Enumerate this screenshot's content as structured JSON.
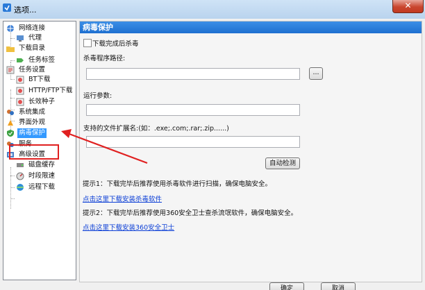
{
  "window": {
    "title": "选项...",
    "close_glyph": "✕"
  },
  "tree": {
    "items": [
      {
        "label": "网络连接",
        "icon": "network-icon"
      },
      {
        "label": "代理",
        "icon": "proxy-icon"
      },
      {
        "label": "下载目录",
        "icon": "folder-icon"
      },
      {
        "label": "任务标签",
        "icon": "tag-icon"
      },
      {
        "label": "任务设置",
        "icon": "task-settings-icon"
      },
      {
        "label": "BT下载",
        "icon": "bt-icon"
      },
      {
        "label": "HTTP/FTP下载",
        "icon": "http-icon"
      },
      {
        "label": "长效种子",
        "icon": "seed-icon"
      },
      {
        "label": "系统集成",
        "icon": "integration-icon"
      },
      {
        "label": "界面外观",
        "icon": "appearance-icon"
      },
      {
        "label": "病毒保护",
        "icon": "shield-icon",
        "selected": true
      },
      {
        "label": "服务",
        "icon": "service-icon"
      },
      {
        "label": "高级设置",
        "icon": "advanced-icon"
      },
      {
        "label": "磁盘缓存",
        "icon": "disk-icon"
      },
      {
        "label": "时段限速",
        "icon": "speed-icon"
      },
      {
        "label": "远程下载",
        "icon": "remote-icon"
      }
    ]
  },
  "panel": {
    "title": "病毒保护",
    "scan_after_download": "下载完成后杀毒",
    "antivirus_path_label": "杀毒程序路径:",
    "antivirus_path_value": "",
    "browse_label": "...",
    "run_params_label": "运行参数:",
    "run_params_value": "",
    "extensions_label": "支持的文件扩展名:(如：.exe;.com;.rar;.zip......)",
    "extensions_value": "",
    "auto_detect_label": "自动检测",
    "tip1": "提示1：下载完毕后推荐使用杀毒软件进行扫描，确保电脑安全。",
    "link1": "点击这里下载安装杀毒软件",
    "tip2": "提示2：下载完毕后推荐使用360安全卫士查杀流氓软件，确保电脑安全。",
    "link2": "点击这里下载安装360安全卫士"
  },
  "footer": {
    "ok_label": "确定",
    "cancel_label": "取消"
  },
  "annotation": {
    "color": "#e02020"
  }
}
